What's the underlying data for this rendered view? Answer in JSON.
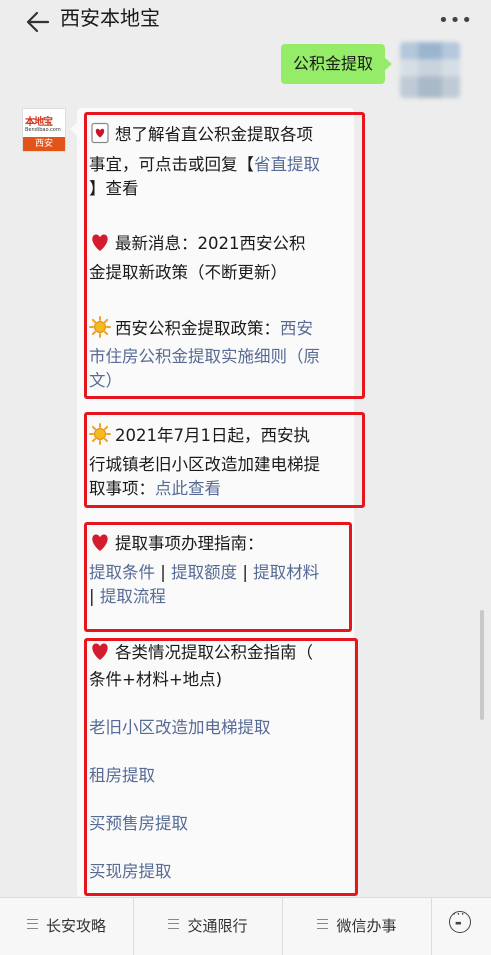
{
  "header": {
    "title": "西安本地宝"
  },
  "user_message": {
    "text": "公积金提取"
  },
  "bot_avatar": {
    "name": "本地宝",
    "url": "Bendibao.com",
    "city": "西安"
  },
  "sections": {
    "s1": {
      "line1": "想了解省直公积金提取各项",
      "line2_text": "事宜，可点击或回复【",
      "line2_link": "省直提取",
      "line3": "】查看"
    },
    "s2": {
      "line1": "最新消息：2021西安公积",
      "line2": "金提取新政策（不断更新）"
    },
    "s3": {
      "line1_text": "西安公积金提取政策：",
      "line1_link": "西安",
      "line2_link": "市住房公积金提取实施细则（原",
      "line3_link": "文）"
    },
    "s4": {
      "line1": "2021年7月1日起，西安执",
      "line2": "行城镇老旧小区改造加建电梯提",
      "line3_text": "取事项：",
      "line3_link": "点此查看"
    },
    "s5": {
      "title": "提取事项办理指南：",
      "links": [
        "提取条件",
        "提取额度",
        "提取材料",
        "提取流程"
      ],
      "separator": "|"
    },
    "s6": {
      "line1": "各类情况提取公积金指南（",
      "line2": "条件+材料+地点)",
      "links": [
        "老旧小区改造加电梯提取",
        "租房提取",
        "买预售房提取",
        "买现房提取"
      ]
    }
  },
  "bottom_tabs": [
    "长安攻略",
    "交通限行",
    "微信办事"
  ],
  "colors": {
    "link": "#576b95",
    "highlight": "#e7151c",
    "user_bubble": "#95ec69"
  }
}
